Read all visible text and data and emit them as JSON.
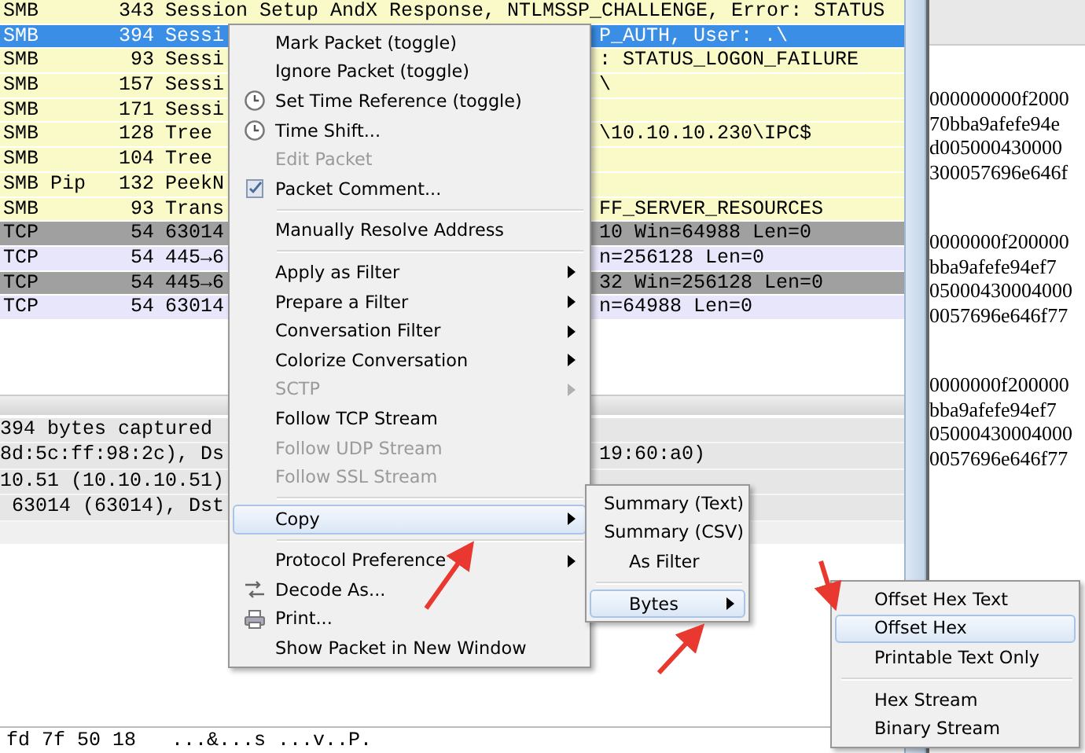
{
  "packet_list": {
    "rows": [
      {
        "protocol": "SMB",
        "length": "343",
        "info_start": "Session Setup AndX Response, NTLMSSP_CHALLENGE, Error: STATUS",
        "kind": "smb",
        "selected": false
      },
      {
        "protocol": "SMB",
        "length": "394",
        "info_start": "Sessi",
        "info_end": "P_AUTH, User: .\\",
        "kind": "smb",
        "selected": true
      },
      {
        "protocol": "SMB",
        "length": "93",
        "info_start": "Sessi",
        "info_end": ": STATUS_LOGON_FAILURE",
        "kind": "smb",
        "selected": false
      },
      {
        "protocol": "SMB",
        "length": "157",
        "info_start": "Sessi",
        "info_end": "\\",
        "kind": "smb",
        "selected": false
      },
      {
        "protocol": "SMB",
        "length": "171",
        "info_start": "Sessi",
        "kind": "smb",
        "selected": false
      },
      {
        "protocol": "SMB",
        "length": "128",
        "info_start": "Tree",
        "info_end": "\\10.10.10.230\\IPC$",
        "kind": "smb",
        "selected": false
      },
      {
        "protocol": "SMB",
        "length": "104",
        "info_start": "Tree",
        "kind": "smb",
        "selected": false
      },
      {
        "protocol": "SMB Pip",
        "length": "132",
        "info_start": "PeekN",
        "kind": "smb",
        "selected": false
      },
      {
        "protocol": "SMB",
        "length": "93",
        "info_start": "Trans",
        "info_end": "FF_SERVER_RESOURCES",
        "kind": "smb",
        "selected": false
      },
      {
        "protocol": "TCP",
        "length": "54",
        "info_start": "63014",
        "info_end": "10 Win=64988 Len=0",
        "kind": "tcp_dark",
        "selected": false
      },
      {
        "protocol": "TCP",
        "length": "54",
        "info_start": "445→6",
        "info_end": "n=256128 Len=0",
        "kind": "tcp_light",
        "selected": false
      },
      {
        "protocol": "TCP",
        "length": "54",
        "info_start": "445→6",
        "info_end": "32 Win=256128 Len=0",
        "kind": "tcp_dark",
        "selected": false
      },
      {
        "protocol": "TCP",
        "length": "54",
        "info_start": "63014",
        "info_end": "n=64988 Len=0",
        "kind": "tcp_light",
        "selected": false
      }
    ]
  },
  "details": [
    {
      "start": "394 bytes captured"
    },
    {
      "start": "8d:5c:ff:98:2c), Ds",
      "end": "19:60:a0)"
    },
    {
      "start": "10.51 (10.10.10.51)"
    },
    {
      "start": " 63014 (63014), Dst"
    }
  ],
  "bytes_line": "fd 7f 50 18   ...&...s ...v..P.",
  "hex_pane": {
    "groups": [
      [
        "000000000f2000",
        "70bba9afefe94e",
        "d005000430000",
        "300057696e646f"
      ],
      [
        "0000000f200000",
        "bba9afefe94ef7",
        "05000430004000",
        "0057696e646f77"
      ],
      [
        "0000000f200000",
        "bba9afefe94ef7",
        "05000430004000",
        "0057696e646f77"
      ]
    ]
  },
  "context_menu": {
    "items": [
      {
        "kind": "plain",
        "label": "Mark Packet (toggle)",
        "disabled": false,
        "submenu": false,
        "selected": false
      },
      {
        "kind": "plain",
        "label": "Ignore Packet (toggle)",
        "disabled": false,
        "submenu": false,
        "selected": false
      },
      {
        "kind": "clock",
        "label": "Set Time Reference (toggle)",
        "disabled": false,
        "submenu": false,
        "selected": false
      },
      {
        "kind": "clock",
        "label": "Time Shift...",
        "disabled": false,
        "submenu": false,
        "selected": false
      },
      {
        "kind": "plain",
        "label": "Edit Packet",
        "disabled": true,
        "submenu": false,
        "selected": false
      },
      {
        "kind": "comment",
        "label": "Packet Comment...",
        "disabled": false,
        "submenu": false,
        "selected": false
      },
      {
        "kind": "separator"
      },
      {
        "kind": "plain",
        "label": "Manually Resolve Address",
        "disabled": false,
        "submenu": false,
        "selected": false
      },
      {
        "kind": "separator"
      },
      {
        "kind": "plain",
        "label": "Apply as Filter",
        "disabled": false,
        "submenu": true,
        "selected": false
      },
      {
        "kind": "plain",
        "label": "Prepare a Filter",
        "disabled": false,
        "submenu": true,
        "selected": false
      },
      {
        "kind": "plain",
        "label": "Conversation Filter",
        "disabled": false,
        "submenu": true,
        "selected": false
      },
      {
        "kind": "plain",
        "label": "Colorize Conversation",
        "disabled": false,
        "submenu": true,
        "selected": false
      },
      {
        "kind": "plain",
        "label": "SCTP",
        "disabled": true,
        "submenu": true,
        "selected": false
      },
      {
        "kind": "plain",
        "label": "Follow TCP Stream",
        "disabled": false,
        "submenu": false,
        "selected": false
      },
      {
        "kind": "plain",
        "label": "Follow UDP Stream",
        "disabled": true,
        "submenu": false,
        "selected": false
      },
      {
        "kind": "plain",
        "label": "Follow SSL Stream",
        "disabled": true,
        "submenu": false,
        "selected": false
      },
      {
        "kind": "separator"
      },
      {
        "kind": "plain",
        "label": "Copy",
        "disabled": false,
        "submenu": true,
        "selected": true
      },
      {
        "kind": "separator"
      },
      {
        "kind": "plain",
        "label": "Protocol Preference",
        "disabled": false,
        "submenu": true,
        "selected": false
      },
      {
        "kind": "decode",
        "label": "Decode As...",
        "disabled": false,
        "submenu": false,
        "selected": false
      },
      {
        "kind": "print",
        "label": "Print...",
        "disabled": false,
        "submenu": false,
        "selected": false
      },
      {
        "kind": "plain",
        "label": "Show Packet in New Window",
        "disabled": false,
        "submenu": false,
        "selected": false
      }
    ]
  },
  "copy_submenu": {
    "items": [
      {
        "kind": "plain",
        "label": "Summary (Text)",
        "disabled": false,
        "submenu": false,
        "selected": false
      },
      {
        "kind": "plain",
        "label": "Summary (CSV)",
        "disabled": false,
        "submenu": false,
        "selected": false
      },
      {
        "kind": "plain",
        "label": "As Filter",
        "disabled": false,
        "submenu": false,
        "selected": false
      },
      {
        "kind": "separator"
      },
      {
        "kind": "plain",
        "label": "Bytes",
        "disabled": false,
        "submenu": true,
        "selected": true
      }
    ]
  },
  "bytes_submenu": {
    "items": [
      {
        "kind": "plain",
        "label": "Offset Hex Text",
        "disabled": false,
        "submenu": false,
        "selected": false
      },
      {
        "kind": "plain",
        "label": "Offset Hex",
        "disabled": false,
        "submenu": false,
        "selected": true
      },
      {
        "kind": "plain",
        "label": "Printable Text Only",
        "disabled": false,
        "submenu": false,
        "selected": false
      },
      {
        "kind": "separator"
      },
      {
        "kind": "plain",
        "label": "Hex Stream",
        "disabled": false,
        "submenu": false,
        "selected": false
      },
      {
        "kind": "plain",
        "label": "Binary Stream",
        "disabled": false,
        "submenu": false,
        "selected": false
      }
    ]
  }
}
